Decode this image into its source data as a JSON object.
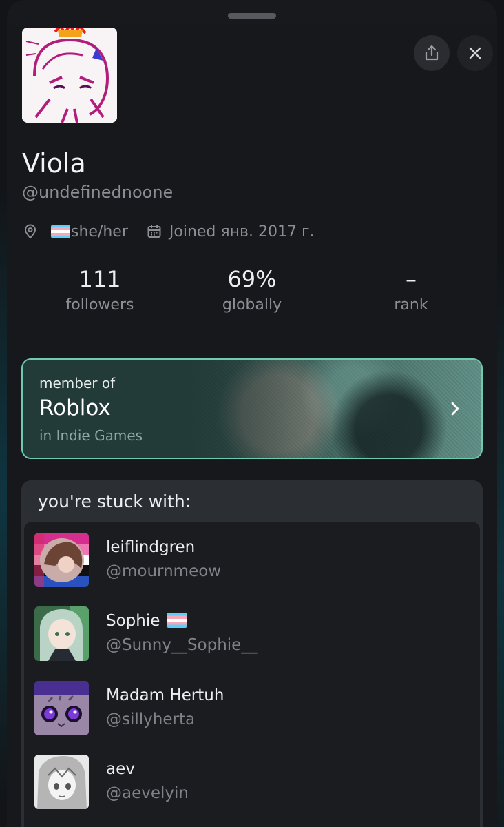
{
  "profile": {
    "display_name": "Viola",
    "handle": "@undefinednoone",
    "location_icon": "location-pin-icon",
    "pronouns": "she/her",
    "joined": "Joined янв. 2017 г."
  },
  "actions": {
    "share_icon": "share-icon",
    "close_icon": "close-icon"
  },
  "stats": [
    {
      "value": "111",
      "label": "followers"
    },
    {
      "value": "69%",
      "label": "globally"
    },
    {
      "value": "–",
      "label": "rank"
    }
  ],
  "membership": {
    "prefix": "member of",
    "group": "Roblox",
    "category": "in Indie Games",
    "accent": "#6fcbb0"
  },
  "stuck_with": {
    "title": "you're stuck with:",
    "users": [
      {
        "name": "leiflindgren",
        "handle": "@mournmeow"
      },
      {
        "name": "Sophie",
        "handle": "@Sunny__Sophie__"
      },
      {
        "name": "Madam Hertuh",
        "handle": "@sillyherta"
      },
      {
        "name": "aev",
        "handle": "@aevelyin"
      }
    ]
  },
  "colors": {
    "background": "#17181b",
    "muted_text": "#8c8f95",
    "card_border": "#6fcbb0",
    "trans_flag": [
      "#5bcefa",
      "#f5a9b8",
      "#ffffff"
    ]
  }
}
